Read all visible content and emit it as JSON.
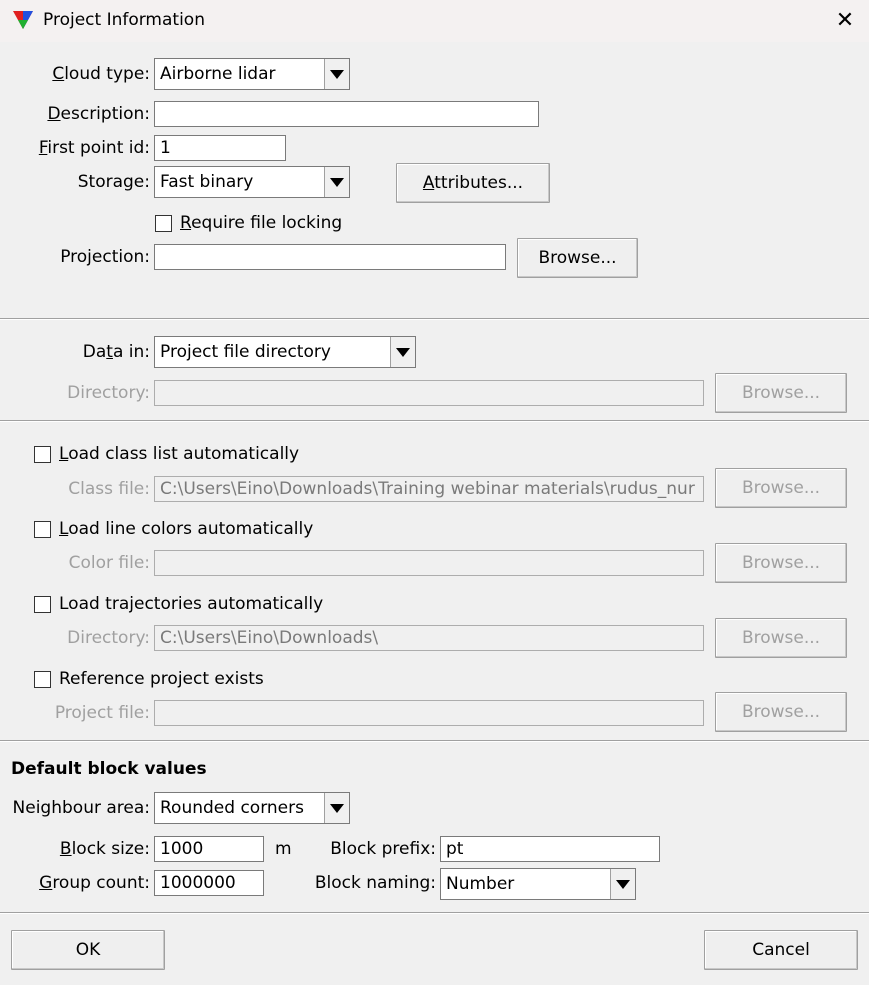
{
  "window": {
    "title": "Project Information",
    "close_glyph": "✕",
    "app_icon": "triangle-logo-icon"
  },
  "general": {
    "cloud_type": {
      "label_pre": "",
      "label_u": "C",
      "label_post": "loud type:",
      "value": "Airborne lidar"
    },
    "description": {
      "label_pre": "",
      "label_u": "D",
      "label_post": "escription:",
      "value": ""
    },
    "first_point_id": {
      "label_pre": "",
      "label_u": "F",
      "label_post": "irst point id:",
      "value": "1"
    },
    "storage": {
      "label": "Storage:",
      "value": "Fast binary"
    },
    "attributes_button": {
      "label_pre": "",
      "label_u": "A",
      "label_post": "ttributes..."
    },
    "require_file_locking": {
      "label_pre": "",
      "label_u": "R",
      "label_post": "equire file locking",
      "checked": false
    },
    "projection": {
      "label": "Projection:",
      "value": "",
      "browse": "Browse..."
    }
  },
  "data": {
    "data_in": {
      "label_pre": "Da",
      "label_u": "t",
      "label_post": "a in:",
      "value": "Project file directory"
    },
    "directory": {
      "label": "Directory:",
      "value": "",
      "browse": "Browse..."
    }
  },
  "loading": {
    "class_list": {
      "label_pre": "",
      "label_u": "L",
      "label_post": "oad class list automatically",
      "checked": false,
      "file_label": "Class file:",
      "file_value": "C:\\Users\\Eino\\Downloads\\Training webinar materials\\rudus_nur",
      "browse": "Browse..."
    },
    "line_colors": {
      "label_pre": "",
      "label_u": "L",
      "label_post": "oad line colors automatically",
      "checked": false,
      "file_label": "Color file:",
      "file_value": "",
      "browse": "Browse..."
    },
    "trajectories": {
      "label": "Load trajectories automatically",
      "checked": false,
      "file_label": "Directory:",
      "file_value": "C:\\Users\\Eino\\Downloads\\",
      "browse": "Browse..."
    },
    "reference": {
      "label": "Reference project exists",
      "checked": false,
      "file_label": "Project file:",
      "file_value": "",
      "browse": "Browse..."
    }
  },
  "block_defaults": {
    "heading": "Default block values",
    "neighbour_area": {
      "label": "Neighbour area:",
      "value": "Rounded corners"
    },
    "block_size": {
      "label_pre": "",
      "label_u": "B",
      "label_post": "lock size:",
      "value": "1000",
      "unit": "m"
    },
    "block_prefix": {
      "label": "Block prefix:",
      "value": "pt"
    },
    "group_count": {
      "label_pre": "",
      "label_u": "G",
      "label_post": "roup count:",
      "value": "1000000"
    },
    "block_naming": {
      "label": "Block naming:",
      "value": "Number"
    }
  },
  "footer": {
    "ok": "OK",
    "cancel": "Cancel"
  }
}
